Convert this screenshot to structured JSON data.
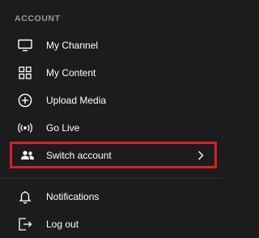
{
  "section": {
    "title": "ACCOUNT"
  },
  "menu": {
    "items": [
      {
        "label": "My Channel",
        "icon": "monitor-icon"
      },
      {
        "label": "My Content",
        "icon": "grid-icon"
      },
      {
        "label": "Upload Media",
        "icon": "plus-circle-icon"
      },
      {
        "label": "Go Live",
        "icon": "broadcast-icon"
      },
      {
        "label": "Switch account",
        "icon": "people-icon",
        "trailing_icon": "chevron-right-icon",
        "highlighted": true
      },
      {
        "label": "Notifications",
        "icon": "bell-icon"
      },
      {
        "label": "Log out",
        "icon": "logout-icon"
      }
    ]
  },
  "colors": {
    "background": "#1c1c1c",
    "text": "#ffffff",
    "section_label": "#9a9a9a",
    "highlight_border": "#d91f26"
  }
}
